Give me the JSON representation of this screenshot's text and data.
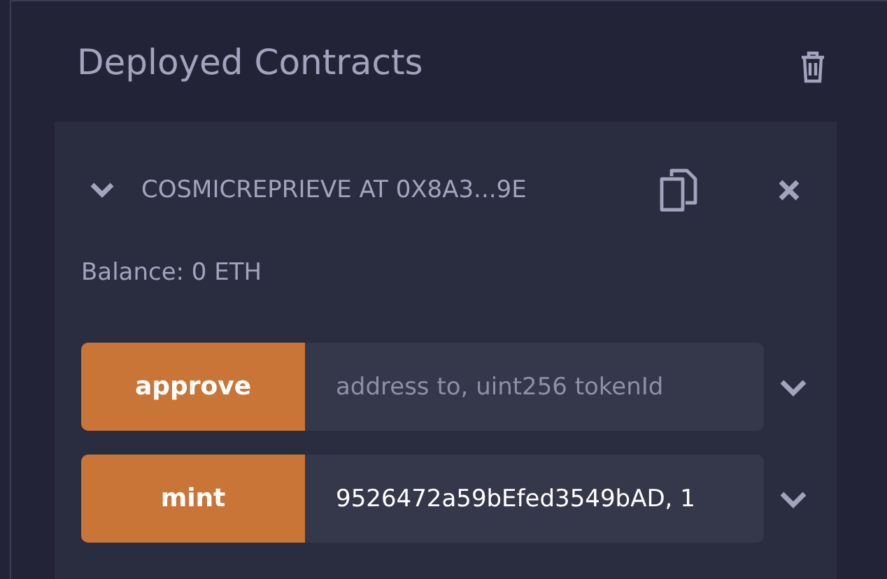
{
  "section": {
    "title": "Deployed Contracts"
  },
  "contract": {
    "name": "COSMICREPRIEVE AT 0X8A3...9E",
    "expanded": true,
    "balance": "Balance: 0 ETH",
    "functions": [
      {
        "name": "approve",
        "placeholder": "address to, uint256 tokenId"
      },
      {
        "name": "mint",
        "value": "9526472a59bEfed3549bAD, 1"
      }
    ]
  }
}
